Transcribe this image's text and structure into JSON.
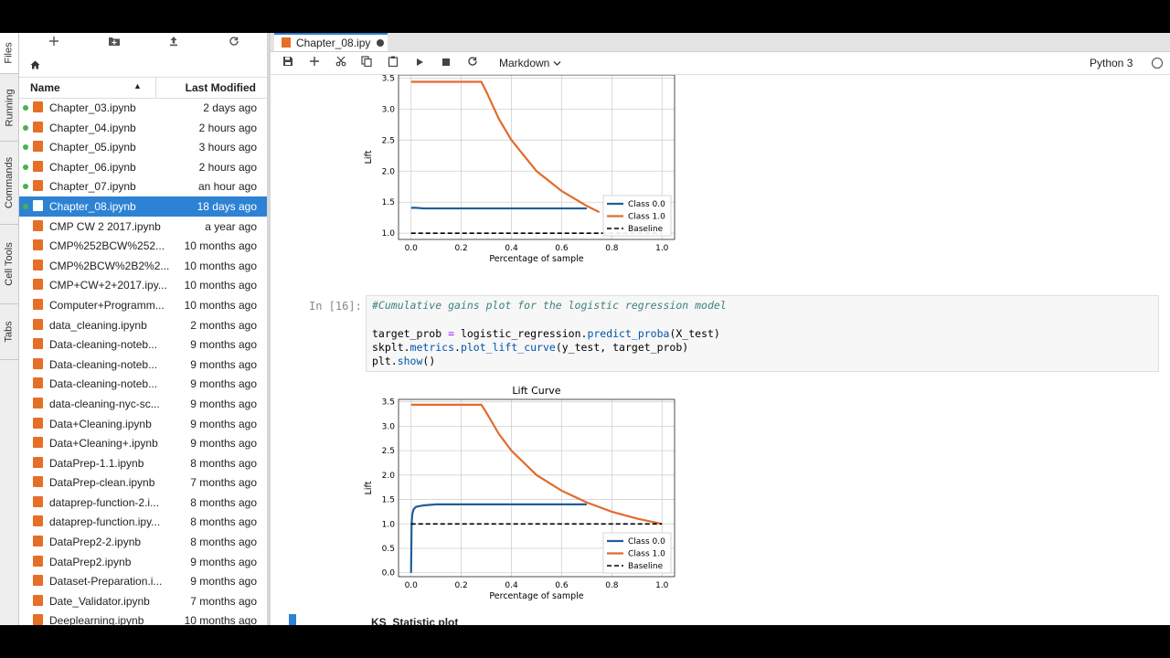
{
  "side_tabs": [
    "Files",
    "Running",
    "Commands",
    "Cell Tools",
    "Tabs"
  ],
  "file_browser": {
    "header_name": "Name",
    "header_modified": "Last Modified",
    "files": [
      {
        "name": "Chapter_03.ipynb",
        "modified": "2 days ago",
        "running": true,
        "selected": false
      },
      {
        "name": "Chapter_04.ipynb",
        "modified": "2 hours ago",
        "running": true,
        "selected": false
      },
      {
        "name": "Chapter_05.ipynb",
        "modified": "3 hours ago",
        "running": true,
        "selected": false
      },
      {
        "name": "Chapter_06.ipynb",
        "modified": "2 hours ago",
        "running": true,
        "selected": false
      },
      {
        "name": "Chapter_07.ipynb",
        "modified": "an hour ago",
        "running": true,
        "selected": false
      },
      {
        "name": "Chapter_08.ipynb",
        "modified": "18 days ago",
        "running": true,
        "selected": true
      },
      {
        "name": "CMP CW 2 2017.ipynb",
        "modified": "a year ago",
        "running": false,
        "selected": false
      },
      {
        "name": "CMP%252BCW%252...",
        "modified": "10 months ago",
        "running": false,
        "selected": false
      },
      {
        "name": "CMP%2BCW%2B2%2...",
        "modified": "10 months ago",
        "running": false,
        "selected": false
      },
      {
        "name": "CMP+CW+2+2017.ipy...",
        "modified": "10 months ago",
        "running": false,
        "selected": false
      },
      {
        "name": "Computer+Programm...",
        "modified": "10 months ago",
        "running": false,
        "selected": false
      },
      {
        "name": "data_cleaning.ipynb",
        "modified": "2 months ago",
        "running": false,
        "selected": false
      },
      {
        "name": "Data-cleaning-noteb...",
        "modified": "9 months ago",
        "running": false,
        "selected": false
      },
      {
        "name": "Data-cleaning-noteb...",
        "modified": "9 months ago",
        "running": false,
        "selected": false
      },
      {
        "name": "Data-cleaning-noteb...",
        "modified": "9 months ago",
        "running": false,
        "selected": false
      },
      {
        "name": "data-cleaning-nyc-sc...",
        "modified": "9 months ago",
        "running": false,
        "selected": false
      },
      {
        "name": "Data+Cleaning.ipynb",
        "modified": "9 months ago",
        "running": false,
        "selected": false
      },
      {
        "name": "Data+Cleaning+.ipynb",
        "modified": "9 months ago",
        "running": false,
        "selected": false
      },
      {
        "name": "DataPrep-1.1.ipynb",
        "modified": "8 months ago",
        "running": false,
        "selected": false
      },
      {
        "name": "DataPrep-clean.ipynb",
        "modified": "7 months ago",
        "running": false,
        "selected": false
      },
      {
        "name": "dataprep-function-2.i...",
        "modified": "8 months ago",
        "running": false,
        "selected": false
      },
      {
        "name": "dataprep-function.ipy...",
        "modified": "8 months ago",
        "running": false,
        "selected": false
      },
      {
        "name": "DataPrep2-2.ipynb",
        "modified": "8 months ago",
        "running": false,
        "selected": false
      },
      {
        "name": "DataPrep2.ipynb",
        "modified": "9 months ago",
        "running": false,
        "selected": false
      },
      {
        "name": "Dataset-Preparation.i...",
        "modified": "9 months ago",
        "running": false,
        "selected": false
      },
      {
        "name": "Date_Validator.ipynb",
        "modified": "7 months ago",
        "running": false,
        "selected": false
      },
      {
        "name": "Deeplearning.ipynb",
        "modified": "10 months ago",
        "running": false,
        "selected": false
      }
    ]
  },
  "notebook": {
    "tab_title": "Chapter_08.ipy",
    "cell_type": "Markdown",
    "kernel": "Python 3",
    "prompt": "In [16]:",
    "code_lines": [
      "#Cumulative gains plot for the logistic regression model",
      "",
      "target_prob = logistic_regression.predict_proba(X_test)",
      "skplt.metrics.plot_lift_curve(y_test, target_prob)",
      "plt.show()"
    ],
    "next_heading": "KS_Statistic plot"
  },
  "colors": {
    "class0": "#1f5f99",
    "class1": "#e06c2e",
    "baseline": "#000000",
    "selection": "#2d82d4"
  },
  "chart_data": [
    {
      "type": "line",
      "title": "",
      "xlabel": "Percentage of sample",
      "ylabel": "Lift",
      "xlim": [
        -0.05,
        1.05
      ],
      "ylim": [
        0.9,
        3.55
      ],
      "xticks": [
        "0.0",
        "0.2",
        "0.4",
        "0.6",
        "0.8",
        "1.0"
      ],
      "yticks": [
        "1.0",
        "1.5",
        "2.0",
        "2.5",
        "3.0",
        "3.5"
      ],
      "legend_position": "bottom-right",
      "grid": true,
      "series": [
        {
          "name": "Class 0.0",
          "x": [
            0.0,
            0.02,
            0.05,
            0.1,
            0.2,
            0.3,
            0.4,
            0.5,
            0.6,
            0.7
          ],
          "y": [
            1.41,
            1.41,
            1.4,
            1.4,
            1.4,
            1.4,
            1.4,
            1.4,
            1.4,
            1.4
          ]
        },
        {
          "name": "Class 1.0",
          "x": [
            0.0,
            0.1,
            0.2,
            0.28,
            0.3,
            0.35,
            0.4,
            0.5,
            0.6,
            0.7,
            0.75
          ],
          "y": [
            3.44,
            3.44,
            3.44,
            3.44,
            3.28,
            2.84,
            2.5,
            2.0,
            1.68,
            1.44,
            1.34
          ]
        },
        {
          "name": "Baseline",
          "x": [
            0.0,
            1.0
          ],
          "y": [
            1.0,
            1.0
          ]
        }
      ]
    },
    {
      "type": "line",
      "title": "Lift Curve",
      "xlabel": "Percentage of sample",
      "ylabel": "Lift",
      "xlim": [
        -0.05,
        1.05
      ],
      "ylim": [
        -0.08,
        3.55
      ],
      "xticks": [
        "0.0",
        "0.2",
        "0.4",
        "0.6",
        "0.8",
        "1.0"
      ],
      "yticks": [
        "0.0",
        "0.5",
        "1.0",
        "1.5",
        "2.0",
        "2.5",
        "3.0",
        "3.5"
      ],
      "legend_position": "bottom-right",
      "grid": true,
      "series": [
        {
          "name": "Class 0.0",
          "x": [
            0.0,
            0.002,
            0.005,
            0.01,
            0.02,
            0.05,
            0.1,
            0.2,
            0.3,
            0.4,
            0.5,
            0.6,
            0.7
          ],
          "y": [
            0.0,
            1.0,
            1.2,
            1.3,
            1.35,
            1.38,
            1.4,
            1.4,
            1.4,
            1.4,
            1.4,
            1.4,
            1.4
          ]
        },
        {
          "name": "Class 1.0",
          "x": [
            0.0,
            0.1,
            0.2,
            0.28,
            0.3,
            0.35,
            0.4,
            0.5,
            0.6,
            0.7,
            0.8,
            0.9,
            1.0
          ],
          "y": [
            3.44,
            3.44,
            3.44,
            3.44,
            3.28,
            2.84,
            2.5,
            2.0,
            1.68,
            1.44,
            1.25,
            1.11,
            1.0
          ]
        },
        {
          "name": "Baseline",
          "x": [
            0.0,
            1.0
          ],
          "y": [
            1.0,
            1.0
          ]
        }
      ]
    }
  ]
}
